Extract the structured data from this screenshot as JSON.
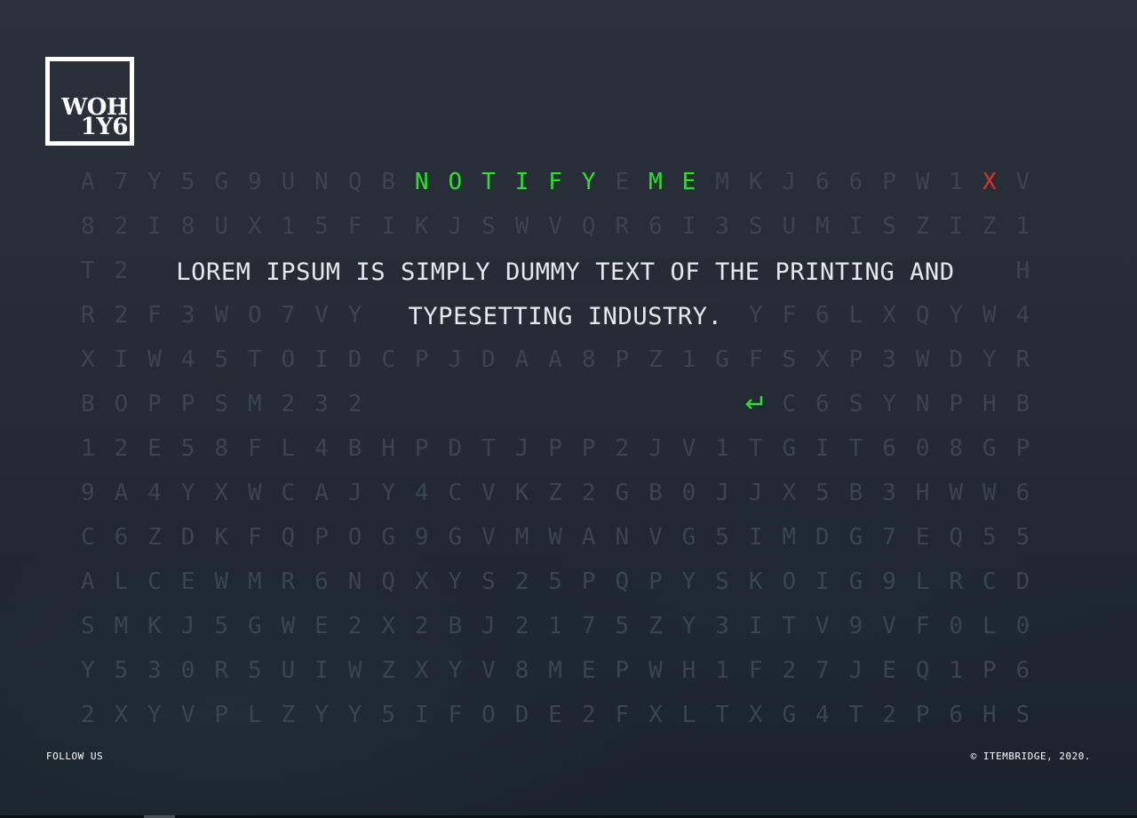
{
  "logo": {
    "line1": "WOH",
    "line2": "1Y6"
  },
  "grid_rows": [
    "A7Y5G9UNQBNOTIFYEMEMKJ66PW1XV",
    "82I8UX15FIKJSWVQR6I3SUMISZIZ1",
    "T2?????????????????????????????H",
    "R2F3WO7VY??????????????YF6LXQYW4",
    "XIW45TOIDCPJDAA8PZ1GFSXP3WDYR",
    "BOPPSM232????????????C6SYNPHB",
    "12E58FL4BHPDTJPP2JV1TGIT608GP",
    "9A4YXWCAJY4CVKZ2GB0JJX5B3HWW6",
    "C6ZDKFQPOG9GVMWANVG5IMDG7EQ55",
    "ALCEWMR6NQXYS25PQPYSKOIG9LRCD",
    "SMKJ5GWE2X2BJ2175ZY3ITV9VF0L0",
    "Y530R5UIWZXYV8MEPWH1F27JEQ1P6",
    "2XYVPLZYY5IFODE2FXLTXG4T2P6HS"
  ],
  "notify": {
    "word1": "NOTIFY",
    "word2": "ME",
    "close_label": "X"
  },
  "message": {
    "line1": "LOREM IPSUM IS SIMPLY DUMMY TEXT OF THE PRINTING AND",
    "line2": "TYPESETTING INDUSTRY."
  },
  "enter_icon": "return-arrow-icon",
  "footer": {
    "follow": "FOLLOW US",
    "copyright": "© ITEMBRIDGE, 2020."
  },
  "colors": {
    "highlight": "#2ee02e",
    "close": "#e0312b",
    "grid_letter": "#3b4450",
    "text": "#e6e9ec"
  }
}
